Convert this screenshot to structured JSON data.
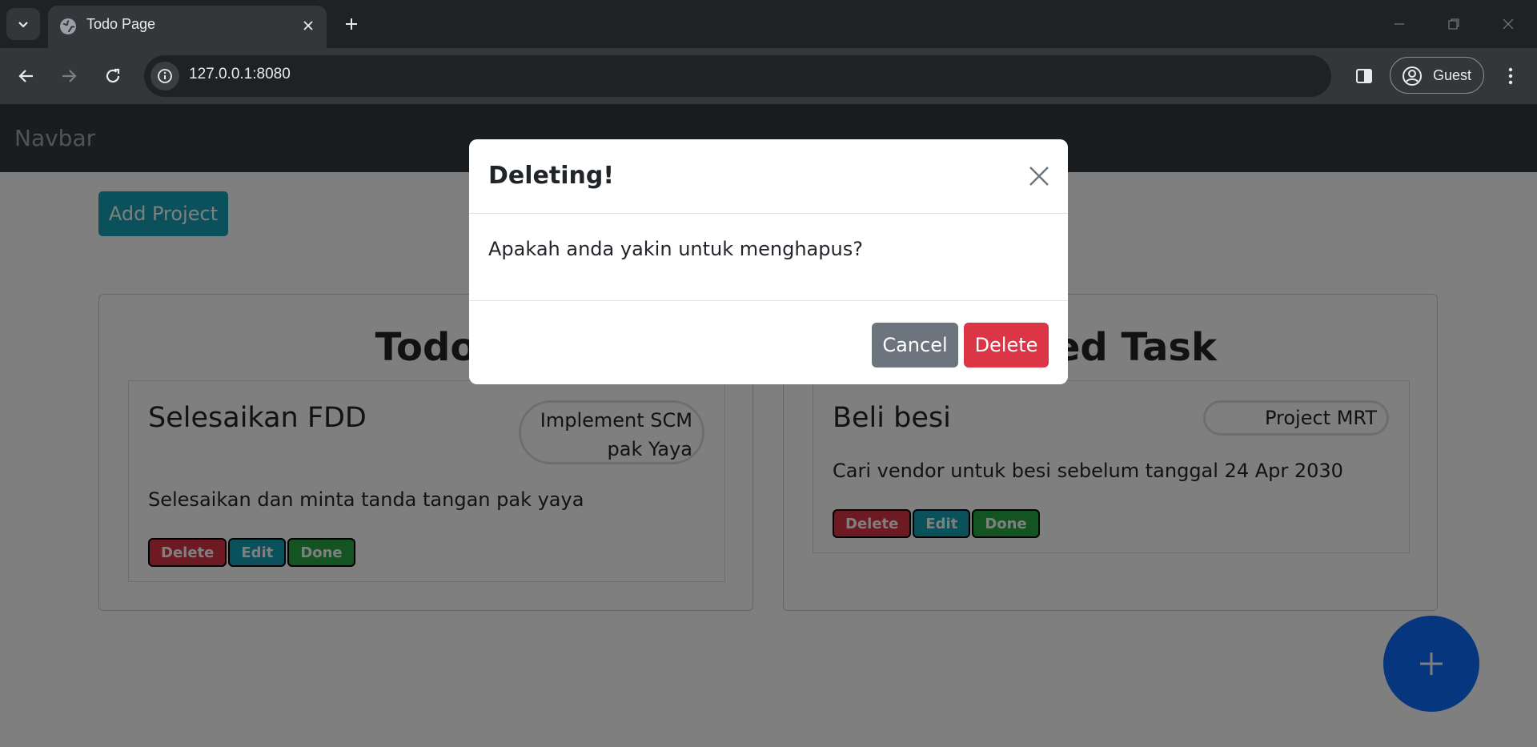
{
  "browser": {
    "tab_title": "Todo Page",
    "url": "127.0.0.1:8080",
    "profile_label": "Guest"
  },
  "navbar": {
    "brand": "Navbar"
  },
  "actions": {
    "add_project": "Add Project"
  },
  "panels": [
    {
      "title": "Todo",
      "task": {
        "title": "Selesaikan FDD",
        "project_line1": "Implement SCM",
        "project_line2": "pak Yaya",
        "description": "Selesaikan dan minta tanda tangan pak yaya",
        "buttons": {
          "delete": "Delete",
          "edit": "Edit",
          "done": "Done"
        }
      }
    },
    {
      "title": "shed Task",
      "task": {
        "title": "Beli besi",
        "project": "Project MRT",
        "description": "Cari vendor untuk besi sebelum tanggal 24 Apr 2030",
        "buttons": {
          "delete": "Delete",
          "edit": "Edit",
          "done": "Done"
        }
      }
    }
  ],
  "modal": {
    "title": "Deleting!",
    "message": "Apakah anda yakin untuk menghapus?",
    "cancel_label": "Cancel",
    "delete_label": "Delete"
  },
  "colors": {
    "primary_fab": "#0d6efd",
    "info": "#17a2b8",
    "danger": "#dc3545",
    "success": "#28a745",
    "secondary": "#6c757d",
    "navbar_bg": "#343a40"
  },
  "icons": {
    "fab": "plus-icon",
    "modal_close": "close-icon",
    "tab_favicon": "globe-icon"
  }
}
